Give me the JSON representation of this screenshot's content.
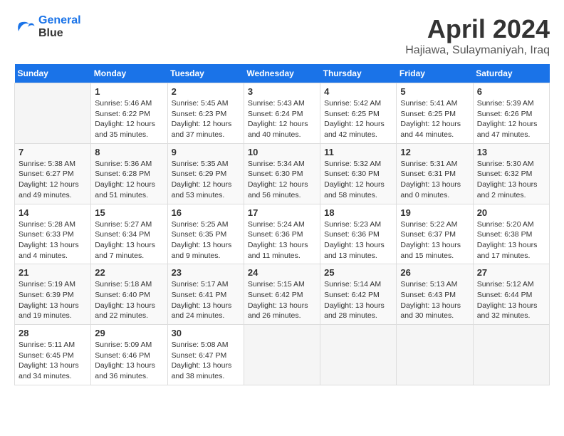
{
  "header": {
    "logo_line1": "General",
    "logo_line2": "Blue",
    "month_title": "April 2024",
    "subtitle": "Hajiawa, Sulaymaniyah, Iraq"
  },
  "weekdays": [
    "Sunday",
    "Monday",
    "Tuesday",
    "Wednesday",
    "Thursday",
    "Friday",
    "Saturday"
  ],
  "weeks": [
    [
      {
        "day": "",
        "empty": true
      },
      {
        "day": "1",
        "sunrise": "5:46 AM",
        "sunset": "6:22 PM",
        "daylight": "12 hours and 35 minutes."
      },
      {
        "day": "2",
        "sunrise": "5:45 AM",
        "sunset": "6:23 PM",
        "daylight": "12 hours and 37 minutes."
      },
      {
        "day": "3",
        "sunrise": "5:43 AM",
        "sunset": "6:24 PM",
        "daylight": "12 hours and 40 minutes."
      },
      {
        "day": "4",
        "sunrise": "5:42 AM",
        "sunset": "6:25 PM",
        "daylight": "12 hours and 42 minutes."
      },
      {
        "day": "5",
        "sunrise": "5:41 AM",
        "sunset": "6:25 PM",
        "daylight": "12 hours and 44 minutes."
      },
      {
        "day": "6",
        "sunrise": "5:39 AM",
        "sunset": "6:26 PM",
        "daylight": "12 hours and 47 minutes."
      }
    ],
    [
      {
        "day": "7",
        "sunrise": "5:38 AM",
        "sunset": "6:27 PM",
        "daylight": "12 hours and 49 minutes."
      },
      {
        "day": "8",
        "sunrise": "5:36 AM",
        "sunset": "6:28 PM",
        "daylight": "12 hours and 51 minutes."
      },
      {
        "day": "9",
        "sunrise": "5:35 AM",
        "sunset": "6:29 PM",
        "daylight": "12 hours and 53 minutes."
      },
      {
        "day": "10",
        "sunrise": "5:34 AM",
        "sunset": "6:30 PM",
        "daylight": "12 hours and 56 minutes."
      },
      {
        "day": "11",
        "sunrise": "5:32 AM",
        "sunset": "6:30 PM",
        "daylight": "12 hours and 58 minutes."
      },
      {
        "day": "12",
        "sunrise": "5:31 AM",
        "sunset": "6:31 PM",
        "daylight": "13 hours and 0 minutes."
      },
      {
        "day": "13",
        "sunrise": "5:30 AM",
        "sunset": "6:32 PM",
        "daylight": "13 hours and 2 minutes."
      }
    ],
    [
      {
        "day": "14",
        "sunrise": "5:28 AM",
        "sunset": "6:33 PM",
        "daylight": "13 hours and 4 minutes."
      },
      {
        "day": "15",
        "sunrise": "5:27 AM",
        "sunset": "6:34 PM",
        "daylight": "13 hours and 7 minutes."
      },
      {
        "day": "16",
        "sunrise": "5:25 AM",
        "sunset": "6:35 PM",
        "daylight": "13 hours and 9 minutes."
      },
      {
        "day": "17",
        "sunrise": "5:24 AM",
        "sunset": "6:36 PM",
        "daylight": "13 hours and 11 minutes."
      },
      {
        "day": "18",
        "sunrise": "5:23 AM",
        "sunset": "6:36 PM",
        "daylight": "13 hours and 13 minutes."
      },
      {
        "day": "19",
        "sunrise": "5:22 AM",
        "sunset": "6:37 PM",
        "daylight": "13 hours and 15 minutes."
      },
      {
        "day": "20",
        "sunrise": "5:20 AM",
        "sunset": "6:38 PM",
        "daylight": "13 hours and 17 minutes."
      }
    ],
    [
      {
        "day": "21",
        "sunrise": "5:19 AM",
        "sunset": "6:39 PM",
        "daylight": "13 hours and 19 minutes."
      },
      {
        "day": "22",
        "sunrise": "5:18 AM",
        "sunset": "6:40 PM",
        "daylight": "13 hours and 22 minutes."
      },
      {
        "day": "23",
        "sunrise": "5:17 AM",
        "sunset": "6:41 PM",
        "daylight": "13 hours and 24 minutes."
      },
      {
        "day": "24",
        "sunrise": "5:15 AM",
        "sunset": "6:42 PM",
        "daylight": "13 hours and 26 minutes."
      },
      {
        "day": "25",
        "sunrise": "5:14 AM",
        "sunset": "6:42 PM",
        "daylight": "13 hours and 28 minutes."
      },
      {
        "day": "26",
        "sunrise": "5:13 AM",
        "sunset": "6:43 PM",
        "daylight": "13 hours and 30 minutes."
      },
      {
        "day": "27",
        "sunrise": "5:12 AM",
        "sunset": "6:44 PM",
        "daylight": "13 hours and 32 minutes."
      }
    ],
    [
      {
        "day": "28",
        "sunrise": "5:11 AM",
        "sunset": "6:45 PM",
        "daylight": "13 hours and 34 minutes."
      },
      {
        "day": "29",
        "sunrise": "5:09 AM",
        "sunset": "6:46 PM",
        "daylight": "13 hours and 36 minutes."
      },
      {
        "day": "30",
        "sunrise": "5:08 AM",
        "sunset": "6:47 PM",
        "daylight": "13 hours and 38 minutes."
      },
      {
        "day": "",
        "empty": true
      },
      {
        "day": "",
        "empty": true
      },
      {
        "day": "",
        "empty": true
      },
      {
        "day": "",
        "empty": true
      }
    ]
  ]
}
